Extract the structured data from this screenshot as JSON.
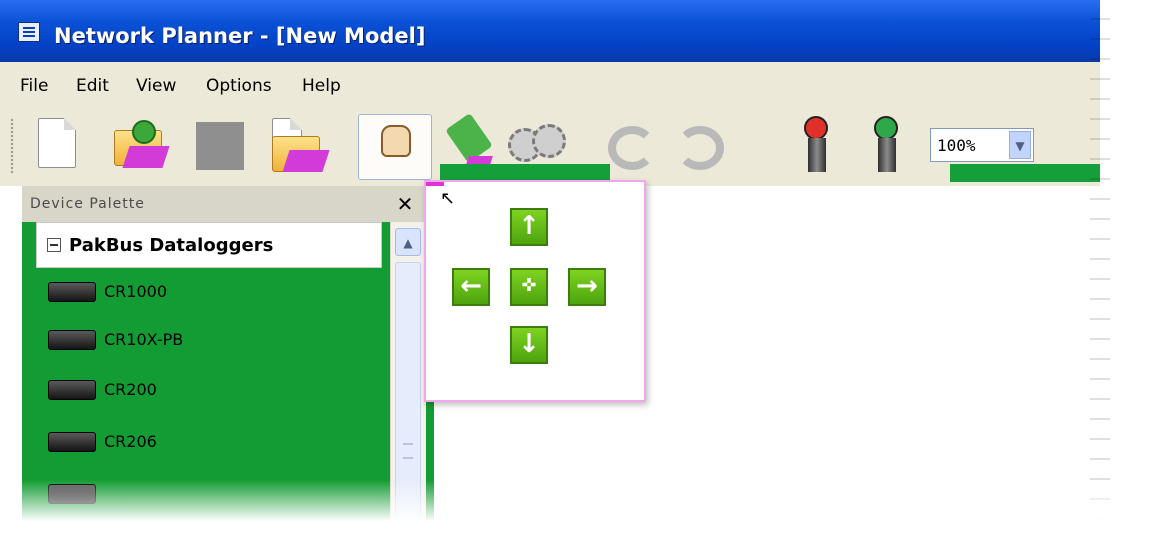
{
  "window": {
    "title": "Network Planner - [New Model]"
  },
  "menu": {
    "items": [
      "File",
      "Edit",
      "View",
      "Options",
      "Help"
    ]
  },
  "toolbar": {
    "buttons": [
      {
        "name": "new-model",
        "icon": "new-document-icon"
      },
      {
        "name": "open-model",
        "icon": "open-folder-icon"
      },
      {
        "name": "save-model",
        "icon": "save-icon"
      },
      {
        "name": "save-as",
        "icon": "save-as-folder-icon"
      },
      {
        "name": "pan-mode",
        "icon": "hand-icon",
        "active": true
      },
      {
        "name": "link-tool",
        "icon": "link-funnel-icon"
      },
      {
        "name": "settings",
        "icon": "gears-icon"
      },
      {
        "name": "undo",
        "icon": "undo-icon"
      },
      {
        "name": "redo",
        "icon": "redo-icon"
      },
      {
        "name": "zoom-out",
        "icon": "zoom-out-icon"
      },
      {
        "name": "zoom-in",
        "icon": "zoom-in-icon"
      }
    ],
    "zoom": {
      "value": "100%"
    }
  },
  "palette": {
    "title": "Device Palette",
    "group": "PakBus Dataloggers",
    "devices": [
      "CR1000",
      "CR10X-PB",
      "CR200",
      "CR206"
    ]
  },
  "pan_control": {
    "up": "↑",
    "down": "↓",
    "left": "←",
    "right": "→",
    "center": "✜"
  },
  "colors": {
    "title_bar": "#0a52d6",
    "palette_green": "#139c33",
    "pan_border": "#f2a6ee",
    "pan_button": "#66bf1a"
  }
}
